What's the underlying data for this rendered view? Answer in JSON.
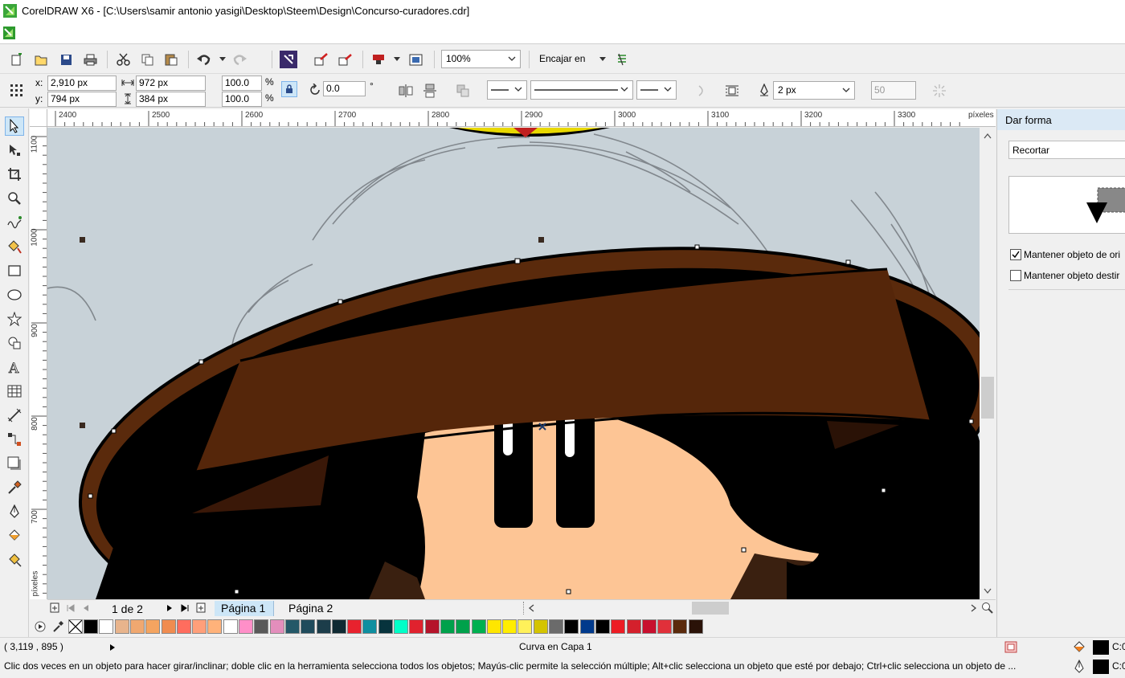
{
  "window": {
    "title": "CorelDRAW X6 - [C:\\Users\\samir antonio yasigi\\Desktop\\Steem\\Design\\Concurso-curadores.cdr]"
  },
  "toolbar": {
    "zoom_value": "100%",
    "snap_label": "Encajar en"
  },
  "property_bar": {
    "x_label": "x:",
    "x_value": "2,910 px",
    "y_label": "y:",
    "y_value": "794 px",
    "width_value": "972 px",
    "height_value": "384 px",
    "scale_w": "100.0",
    "scale_h": "100.0",
    "percent_symbol": "%",
    "rotation_value": "0.0",
    "degree_symbol": "°",
    "outline_width": "2 px",
    "miter_value": "50"
  },
  "rulers": {
    "unit_label": "píxeles",
    "h_ticks": [
      "2400",
      "2500",
      "2600",
      "2700",
      "2800",
      "2900",
      "3000",
      "3100",
      "3200",
      "3300"
    ],
    "v_ticks": [
      "1100",
      "1000",
      "900",
      "800",
      "700"
    ]
  },
  "page_nav": {
    "page_count": "1 de 2",
    "tabs": [
      "Página 1",
      "Página 2"
    ]
  },
  "palette": {
    "colors": [
      "#000000",
      "#ffffff",
      "#e8b48c",
      "#f0a870",
      "#f4a460",
      "#f08c50",
      "#ff6d5e",
      "#ff9f7a",
      "#ffb27a",
      "#ffffff",
      "#ff8fc8",
      "#595959",
      "#e38ebc",
      "#245868",
      "#1f4b5c",
      "#1c3d4a",
      "#0f2a33",
      "#e8222e",
      "#0f8fa0",
      "#07333d",
      "#00ffc8",
      "#e0222e",
      "#b5142a",
      "#00a14b",
      "#00a14b",
      "#00b050",
      "#ffe600",
      "#ffed00",
      "#fff15a",
      "#d4c400",
      "#6b6b6b",
      "#000000",
      "#003a8c",
      "#000000",
      "#ed1c24",
      "#d4202c",
      "#c8102e",
      "#e0303a",
      "#5a2a0c",
      "#2a1208"
    ]
  },
  "status": {
    "cursor_coords": "( 3,119 , 895  )",
    "object_info": "Curva en Capa 1",
    "hint": "Clic dos veces en un objeto para hacer girar/inclinar; doble clic en la herramienta selecciona todos los objetos; Mayús-clic permite la selección múltiple; Alt+clic selecciona un objeto que esté por debajo; Ctrl+clic selecciona un objeto de ...",
    "fill_label": "C:0",
    "outline_label": "C:0"
  },
  "docker": {
    "title": "Dar forma",
    "mode": "Recortar",
    "keep_source_label": "Mantener objeto de ori",
    "keep_source_checked": true,
    "keep_target_label": "Mantener objeto destir",
    "keep_target_checked": false
  },
  "artwork": {
    "hat_color": "#5a2a0c",
    "hat_outline": "#000000",
    "skin_color": "#fdc595",
    "paper_color": "#c9d3d9"
  }
}
